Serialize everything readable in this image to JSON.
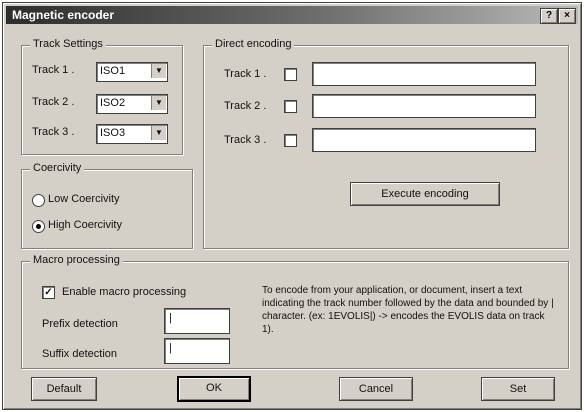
{
  "window": {
    "title": "Magnetic encoder",
    "help_label": "?",
    "close_label": "×"
  },
  "track_settings": {
    "legend": "Track Settings",
    "tracks": [
      {
        "label": "Track 1 .",
        "value": "ISO1"
      },
      {
        "label": "Track 2 .",
        "value": "ISO2"
      },
      {
        "label": "Track 3 .",
        "value": "ISO3"
      }
    ],
    "arrow_icon": "chevron-down-icon"
  },
  "coercivity": {
    "legend": "Coercivity",
    "options": [
      {
        "label": "Low Coercivity",
        "selected": false
      },
      {
        "label": "High Coercivity",
        "selected": true
      }
    ]
  },
  "direct_encoding": {
    "legend": "Direct encoding",
    "tracks": [
      {
        "label": "Track 1 .",
        "checked": false,
        "value": ""
      },
      {
        "label": "Track 2 .",
        "checked": false,
        "value": ""
      },
      {
        "label": "Track 3 .",
        "checked": false,
        "value": ""
      }
    ],
    "execute_label": "Execute encoding"
  },
  "macro": {
    "legend": "Macro processing",
    "enable_label": "Enable macro processing",
    "enable_checked": true,
    "prefix_label": "Prefix detection",
    "prefix_value": "|",
    "suffix_label": "Suffix detection",
    "suffix_value": "|",
    "note": "To encode from your application, or document, insert a text indicating the track number followed by the data and bounded by | character. (ex: 1EVOLIS|) -> encodes the EVOLIS data on track 1)."
  },
  "buttons": {
    "default": "Default",
    "ok": "OK",
    "cancel": "Cancel",
    "set": "Set"
  }
}
